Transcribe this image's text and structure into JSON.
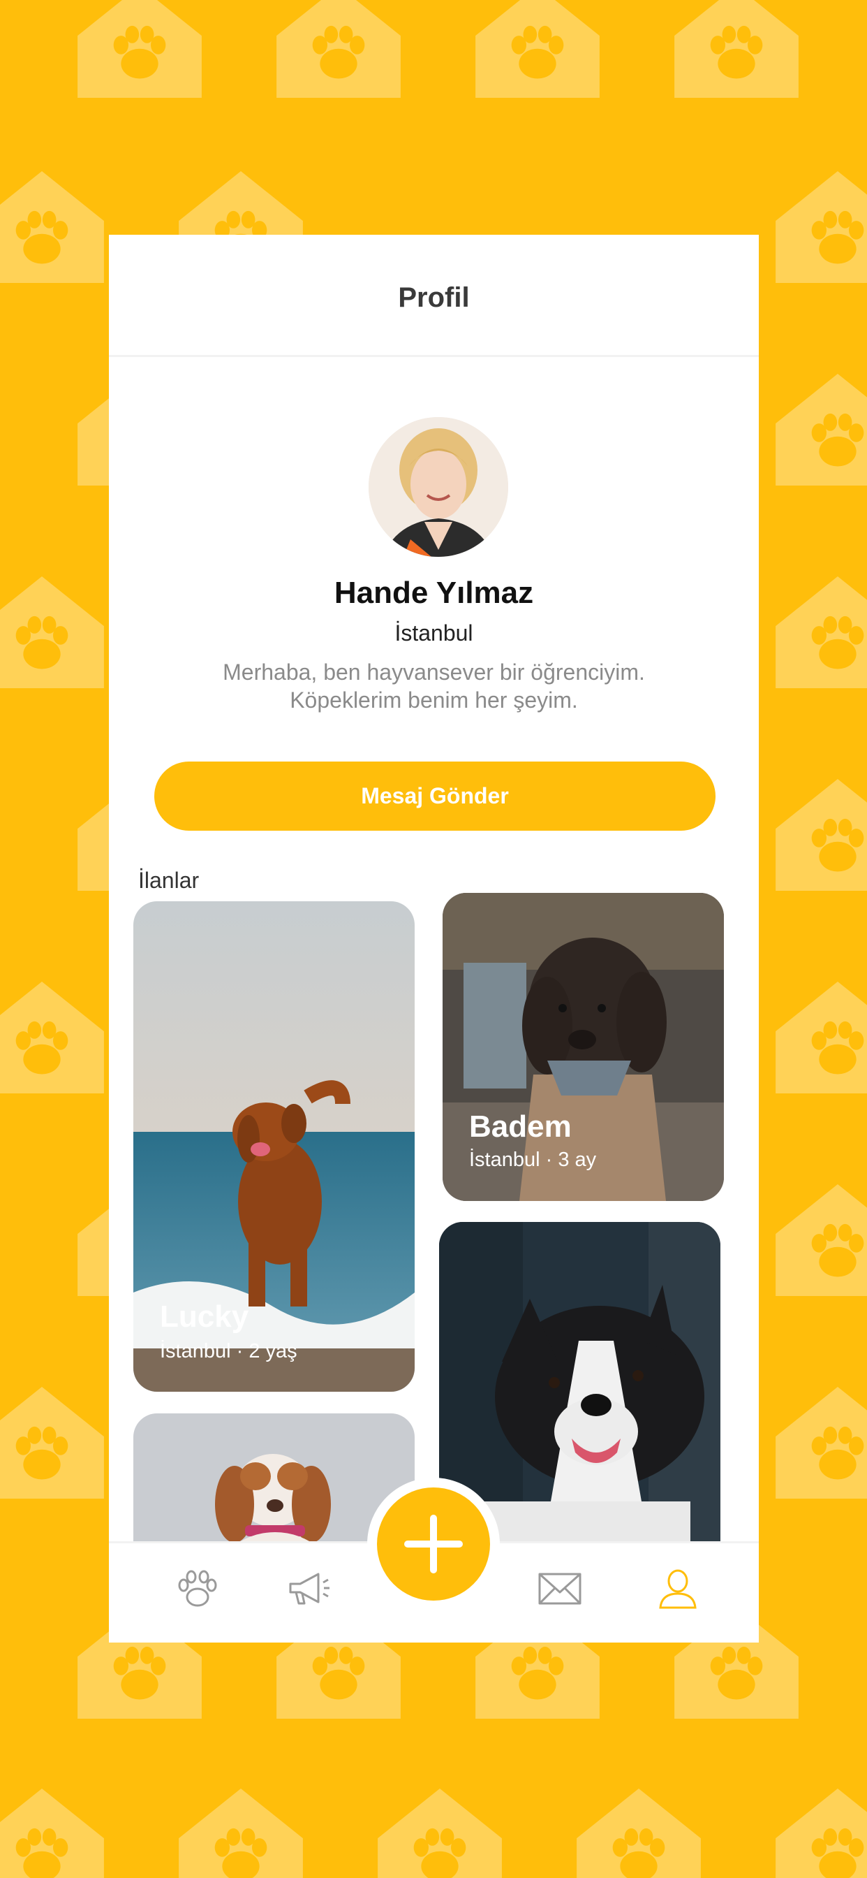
{
  "colors": {
    "brand": "#FFBE0B",
    "pattern": "#FFD257",
    "text_dark": "#3a3a3a",
    "text_muted": "#8a8a8a",
    "tab_active": "#FFBE0B",
    "tab_inactive": "#9a9a9a"
  },
  "header": {
    "title": "Profil"
  },
  "profile": {
    "name": "Hande Yılmaz",
    "city": "İstanbul",
    "bio": "Merhaba, ben hayvansever bir öğrenciyim. Köpeklerim benim her şeyim.",
    "send_message_label": "Mesaj Gönder"
  },
  "listings": {
    "label": "İlanlar",
    "items": [
      {
        "name": "Lucky",
        "meta": "İstanbul · 2 yaş"
      },
      {
        "name": "Badem",
        "meta": "İstanbul · 3 ay"
      }
    ]
  },
  "tabbar": {
    "items": [
      {
        "icon": "paw-icon",
        "active": false
      },
      {
        "icon": "megaphone-icon",
        "active": false
      },
      {
        "icon": "envelope-icon",
        "active": false
      },
      {
        "icon": "user-icon",
        "active": true
      }
    ],
    "add_icon": "plus-icon"
  }
}
